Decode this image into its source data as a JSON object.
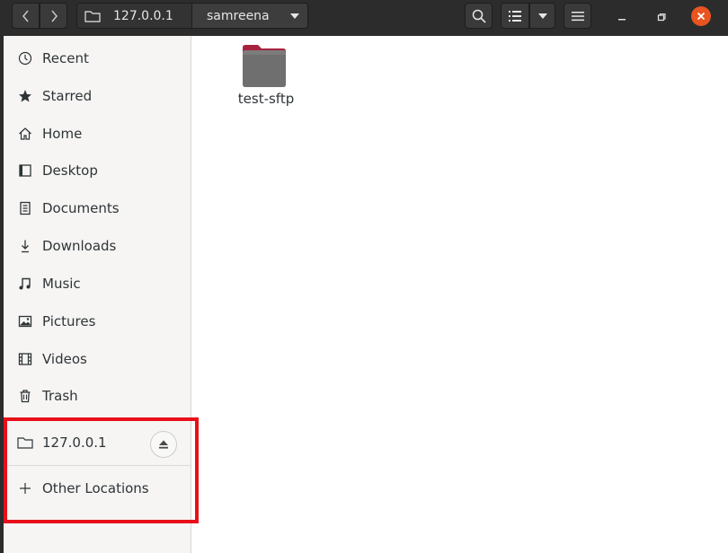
{
  "headerbar": {
    "path": [
      "127.0.0.1",
      "samreena"
    ]
  },
  "sidebar": {
    "items": [
      {
        "label": "Recent",
        "icon": "clock-icon"
      },
      {
        "label": "Starred",
        "icon": "star-icon"
      },
      {
        "label": "Home",
        "icon": "home-icon"
      },
      {
        "label": "Desktop",
        "icon": "desktop-icon"
      },
      {
        "label": "Documents",
        "icon": "document-icon"
      },
      {
        "label": "Downloads",
        "icon": "download-icon"
      },
      {
        "label": "Music",
        "icon": "music-icon"
      },
      {
        "label": "Pictures",
        "icon": "picture-icon"
      },
      {
        "label": "Videos",
        "icon": "video-icon"
      },
      {
        "label": "Trash",
        "icon": "trash-icon"
      }
    ],
    "mounted": {
      "label": "127.0.0.1",
      "icon": "network-folder-icon"
    },
    "other_locations": {
      "label": "Other Locations",
      "icon": "plus-icon"
    }
  },
  "content": {
    "files": [
      {
        "name": "test-sftp",
        "type": "folder"
      }
    ]
  },
  "colors": {
    "headerbar": "#2c2c2c",
    "sidebar": "#f6f5f4",
    "close_button": "#e95420",
    "highlight_box": "#e8101a",
    "folder": "#6f6f6f",
    "folder_tab": "#a6233f"
  }
}
